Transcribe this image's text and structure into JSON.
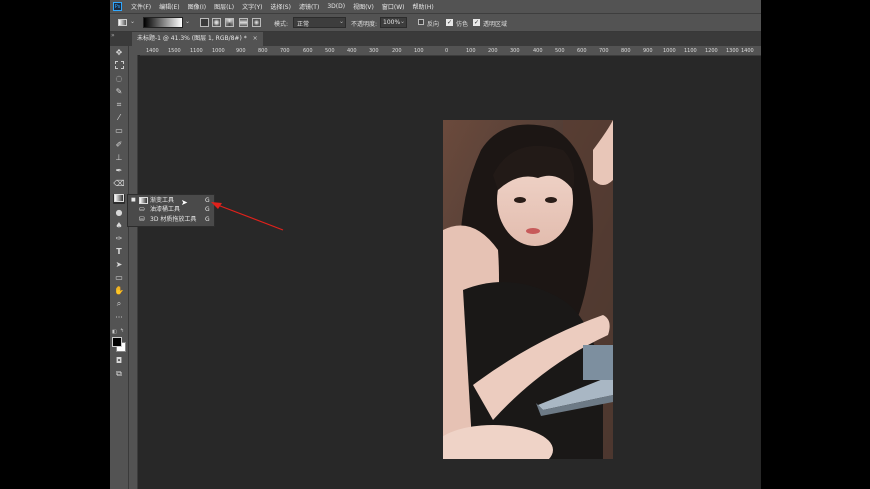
{
  "app": {
    "logo": "Ps"
  },
  "menus": [
    "文件(F)",
    "编辑(E)",
    "图像(I)",
    "图层(L)",
    "文字(Y)",
    "选择(S)",
    "滤镜(T)",
    "3D(D)",
    "视图(V)",
    "窗口(W)",
    "帮助(H)"
  ],
  "options": {
    "mode_label": "模式:",
    "mode_value": "正常",
    "opacity_label": "不透明度:",
    "opacity_value": "100%",
    "reverse_label": "反向",
    "dither_label": "仿色",
    "transparency_label": "透明区域"
  },
  "document_tab": {
    "title": "未标题-1 @ 41.3% (图层 1, RGB/8#) *",
    "close": "×"
  },
  "ruler_ticks": [
    "1400",
    "1500",
    "1100",
    "1000",
    "900",
    "800",
    "700",
    "600",
    "500",
    "400",
    "300",
    "200",
    "100",
    "0",
    "100",
    "200",
    "300",
    "400",
    "500",
    "600",
    "700",
    "800",
    "900",
    "1000",
    "1100",
    "1200",
    "1300",
    "1400"
  ],
  "flyout": {
    "items": [
      {
        "label": "渐变工具",
        "key": "G",
        "icon": "gradient-icon",
        "selected": true
      },
      {
        "label": "油漆桶工具",
        "key": "G",
        "icon": "paint-bucket-icon",
        "selected": false
      },
      {
        "label": "3D 材质拖放工具",
        "key": "G",
        "icon": "3d-material-drop-icon",
        "selected": false
      }
    ]
  },
  "colors": {
    "annotation_arrow": "#e0211b",
    "ps_accent": "#31a8ff"
  }
}
